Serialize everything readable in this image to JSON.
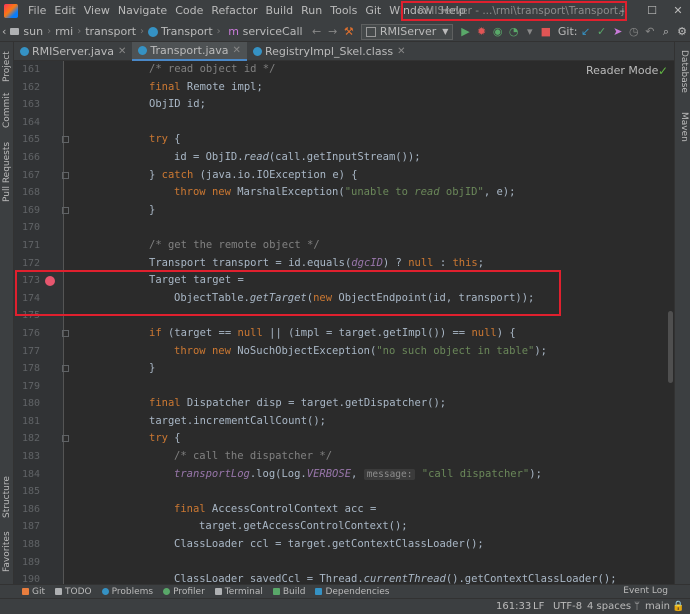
{
  "menu": [
    "File",
    "Edit",
    "View",
    "Navigate",
    "Code",
    "Refactor",
    "Build",
    "Run",
    "Tools",
    "Git",
    "Window",
    "Help"
  ],
  "window_title": "RMIServer - ...\\rmi\\transport\\Transport.java",
  "breadcrumbs": [
    "sun",
    "rmi",
    "transport",
    "Transport",
    "serviceCall"
  ],
  "run_config": "RMIServer",
  "git_label": "Git:",
  "tabs": [
    {
      "label": "RMIServer.java",
      "icon": "class-icon"
    },
    {
      "label": "Transport.java",
      "icon": "class-icon"
    },
    {
      "label": "RegistryImpl_Skel.class",
      "icon": "class-icon"
    }
  ],
  "left_tools": [
    "Project",
    "Commit",
    "Pull Requests",
    "Structure",
    "Favorites"
  ],
  "right_tools": [
    "Database",
    "Maven"
  ],
  "reader_mode": "Reader Mode",
  "lines": [
    {
      "num": "161",
      "text": "/* read object id */"
    },
    {
      "num": "162",
      "text": "final Remote impl;"
    },
    {
      "num": "163",
      "text": "ObjID id;"
    },
    {
      "num": "164",
      "text": ""
    },
    {
      "num": "165",
      "text": "try {"
    },
    {
      "num": "166",
      "text": "id = ObjID.read(call.getInputStream());"
    },
    {
      "num": "167",
      "text": "} catch (java.io.IOException e) {"
    },
    {
      "num": "168",
      "text": "throw new MarshalException(\"unable to read objID\", e);"
    },
    {
      "num": "169",
      "text": "}"
    },
    {
      "num": "170",
      "text": ""
    },
    {
      "num": "171",
      "text": "/* get the remote object */"
    },
    {
      "num": "172",
      "text": "Transport transport = id.equals(dgcID) ? null : this;"
    },
    {
      "num": "173",
      "text": "Target target ="
    },
    {
      "num": "174",
      "text": "ObjectTable.getTarget(new ObjectEndpoint(id, transport));"
    },
    {
      "num": "175",
      "text": ""
    },
    {
      "num": "176",
      "text": "if (target == null || (impl = target.getImpl()) == null) {"
    },
    {
      "num": "177",
      "text": "throw new NoSuchObjectException(\"no such object in table\");"
    },
    {
      "num": "178",
      "text": "}"
    },
    {
      "num": "179",
      "text": ""
    },
    {
      "num": "180",
      "text": "final Dispatcher disp = target.getDispatcher();"
    },
    {
      "num": "181",
      "text": "target.incrementCallCount();"
    },
    {
      "num": "182",
      "text": "try {"
    },
    {
      "num": "183",
      "text": "/* call the dispatcher */"
    },
    {
      "num": "184",
      "text": "transportLog.log(Log.VERBOSE, message: \"call dispatcher\");"
    },
    {
      "num": "185",
      "text": ""
    },
    {
      "num": "186",
      "text": "final AccessControlContext acc ="
    },
    {
      "num": "187",
      "text": "target.getAccessControlContext();"
    },
    {
      "num": "188",
      "text": "ClassLoader ccl = target.getContextClassLoader();"
    },
    {
      "num": "189",
      "text": ""
    },
    {
      "num": "190",
      "text": "ClassLoader savedCcl = Thread.currentThread().getContextClassLoader();"
    }
  ],
  "bottom_tools": [
    "Git",
    "TODO",
    "Problems",
    "Profiler",
    "Terminal",
    "Build",
    "Dependencies"
  ],
  "event_log": "Event Log",
  "status": {
    "position": "161:33",
    "line_sep": "LF",
    "encoding": "UTF-8",
    "indent": "4 spaces",
    "branch": "main"
  },
  "colors": {
    "highlight_border": "#e0202e",
    "breakpoint": "#e6566e",
    "keyword": "#cc7832",
    "string": "#6a8759",
    "comment": "#808080"
  }
}
